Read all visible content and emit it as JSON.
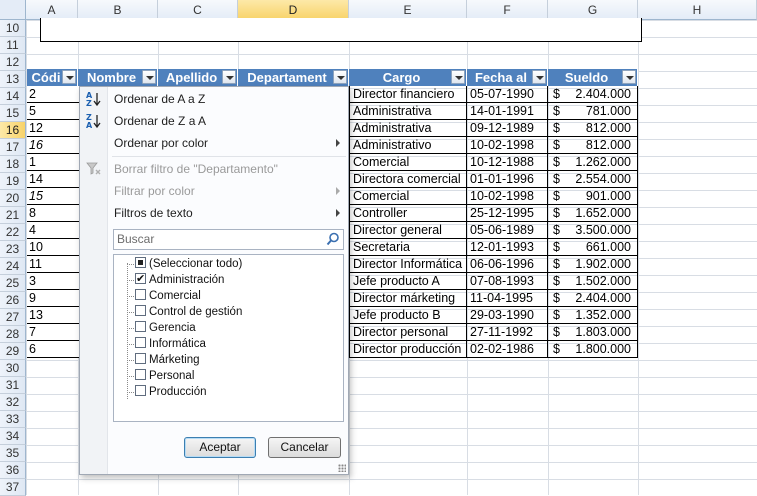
{
  "columns": [
    "A",
    "B",
    "C",
    "D",
    "E",
    "F",
    "G",
    "H"
  ],
  "rows": [
    "10",
    "11",
    "12",
    "13",
    "14",
    "15",
    "16",
    "17",
    "18",
    "19",
    "20",
    "21",
    "22",
    "23",
    "24",
    "25",
    "26",
    "27",
    "28",
    "29",
    "30",
    "31",
    "32",
    "33",
    "34",
    "35",
    "36",
    "37"
  ],
  "table": {
    "headers": {
      "codigo": "Códi",
      "nombre": "Nombre",
      "apellido": "Apellido",
      "departamento": "Departament",
      "cargo": "Cargo",
      "fecha": "Fecha al",
      "sueldo": "Sueldo"
    },
    "codigos": [
      "2",
      "5",
      "12",
      "16",
      "1",
      "14",
      "15",
      "8",
      "4",
      "10",
      "11",
      "3",
      "9",
      "13",
      "7",
      "6"
    ],
    "cargos": [
      "Director financiero",
      "Administrativa",
      "Administrativa",
      "Administrativo",
      "Comercial",
      "Directora comercial",
      "Comercial",
      "Controller",
      "Director general",
      "Secretaria",
      "Director Informática",
      "Jefe producto A",
      "Director márketing",
      "Jefe producto B",
      "Director personal",
      "Director producción"
    ],
    "fechas": [
      "05-07-1990",
      "14-01-1991",
      "09-12-1989",
      "10-02-1998",
      "10-12-1988",
      "01-01-1996",
      "10-02-1998",
      "25-12-1995",
      "05-06-1989",
      "12-01-1993",
      "06-06-1996",
      "07-08-1993",
      "11-04-1995",
      "29-03-1990",
      "27-11-1992",
      "02-02-1986"
    ],
    "currency": "$",
    "sueldos": [
      "2.404.000",
      "781.000",
      "812.000",
      "812.000",
      "1.262.000",
      "2.554.000",
      "901.000",
      "1.652.000",
      "3.500.000",
      "661.000",
      "1.902.000",
      "1.502.000",
      "2.404.000",
      "1.352.000",
      "1.803.000",
      "1.800.000"
    ]
  },
  "filter_menu": {
    "sort_asc": "Ordenar de A a Z",
    "sort_desc": "Ordenar de Z a A",
    "sort_color": "Ordenar por color",
    "clear_filter": "Borrar filtro de \"Departamento\"",
    "filter_color": "Filtrar por color",
    "text_filters": "Filtros de texto",
    "search_placeholder": "Buscar",
    "items": [
      {
        "label": "(Seleccionar todo)",
        "state": "partial"
      },
      {
        "label": "Administración",
        "state": "checked"
      },
      {
        "label": "Comercial",
        "state": "unchecked"
      },
      {
        "label": "Control de gestión",
        "state": "unchecked"
      },
      {
        "label": "Gerencia",
        "state": "unchecked"
      },
      {
        "label": "Informática",
        "state": "unchecked"
      },
      {
        "label": "Márketing",
        "state": "unchecked"
      },
      {
        "label": "Personal",
        "state": "unchecked"
      },
      {
        "label": "Producción",
        "state": "unchecked"
      }
    ],
    "ok_label": "Aceptar",
    "cancel_label": "Cancelar"
  }
}
